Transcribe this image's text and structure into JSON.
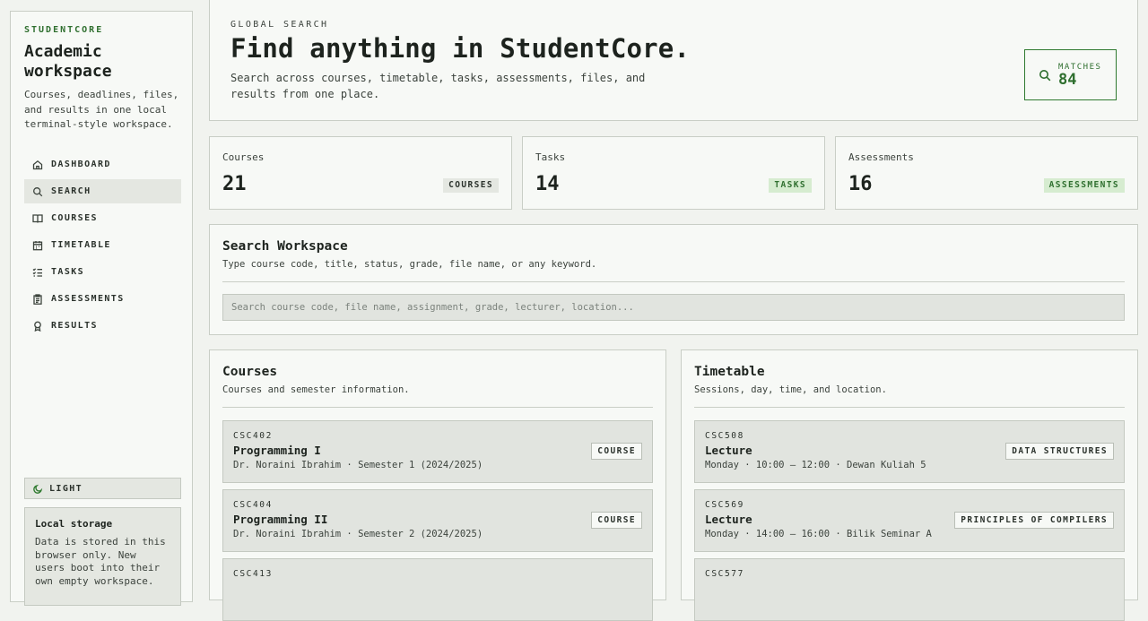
{
  "sidebar": {
    "brand": "STUDENTCORE",
    "title": "Academic workspace",
    "description": "Courses, deadlines, files, and results in one local terminal-style workspace.",
    "nav": [
      {
        "label": "DASHBOARD",
        "icon": "home-icon"
      },
      {
        "label": "SEARCH",
        "icon": "search-icon",
        "active": true
      },
      {
        "label": "COURSES",
        "icon": "book-icon"
      },
      {
        "label": "TIMETABLE",
        "icon": "calendar-icon"
      },
      {
        "label": "TASKS",
        "icon": "checklist-icon"
      },
      {
        "label": "ASSESSMENTS",
        "icon": "clipboard-icon"
      },
      {
        "label": "RESULTS",
        "icon": "award-icon"
      }
    ],
    "theme_label": "LIGHT",
    "storage": {
      "title": "Local storage",
      "text": "Data is stored in this browser only. New users boot into their own empty workspace."
    }
  },
  "hero": {
    "eyebrow": "GLOBAL SEARCH",
    "title": "Find anything in StudentCore.",
    "description": "Search across courses, timetable, tasks, assessments, files, and results from one place.",
    "matches_label": "MATCHES",
    "matches_value": "84"
  },
  "stats": [
    {
      "label": "Courses",
      "value": "21",
      "badge": "COURSES"
    },
    {
      "label": "Tasks",
      "value": "14",
      "badge": "TASKS"
    },
    {
      "label": "Assessments",
      "value": "16",
      "badge": "ASSESSMENTS"
    }
  ],
  "search": {
    "title": "Search Workspace",
    "subtitle": "Type course code, title, status, grade, file name, or any keyword.",
    "placeholder": "Search course code, file name, assignment, grade, lecturer, location...",
    "value": ""
  },
  "courses": {
    "title": "Courses",
    "subtitle": "Courses and semester information.",
    "items": [
      {
        "code": "CSC402",
        "title": "Programming I",
        "meta": "Dr. Noraini Ibrahim · Semester 1 (2024/2025)",
        "tag": "COURSE"
      },
      {
        "code": "CSC404",
        "title": "Programming II",
        "meta": "Dr. Noraini Ibrahim · Semester 2 (2024/2025)",
        "tag": "COURSE"
      },
      {
        "code": "CSC413",
        "title": "",
        "meta": "",
        "tag": ""
      }
    ]
  },
  "timetable": {
    "title": "Timetable",
    "subtitle": "Sessions, day, time, and location.",
    "items": [
      {
        "code": "CSC508",
        "title": "Lecture",
        "meta": "Monday · 10:00 – 12:00 · Dewan Kuliah 5",
        "tag": "DATA STRUCTURES"
      },
      {
        "code": "CSC569",
        "title": "Lecture",
        "meta": "Monday · 14:00 – 16:00 · Bilik Seminar A",
        "tag": "PRINCIPLES OF COMPILERS"
      },
      {
        "code": "CSC577",
        "title": "",
        "meta": "",
        "tag": ""
      }
    ]
  },
  "colors": {
    "accent": "#2f7a2f",
    "background": "#f1f3ef",
    "panel": "#f7f9f6",
    "row": "#e1e4df"
  }
}
